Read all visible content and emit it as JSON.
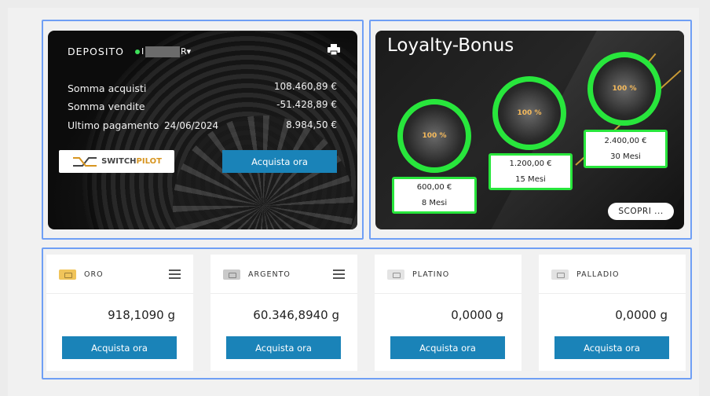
{
  "deposit": {
    "title": "DEPOSITO",
    "account_prefix": "I",
    "account_suffix": "R▾",
    "status_color": "#3ee05a",
    "rows": [
      {
        "label": "Somma acquisti",
        "value": "108.460,89 €"
      },
      {
        "label": "Somma vendite",
        "value": "-51.428,89 €"
      },
      {
        "label": "Ultimo pagamento",
        "date": "24/06/2024",
        "value": "8.984,50 €"
      }
    ],
    "logo_text_a": "SWITCH",
    "logo_text_b": "PILOT",
    "buy_label": "Acquista ora"
  },
  "loyalty": {
    "title": "Loyalty-Bonus",
    "tiers": [
      {
        "percent": "100 %",
        "amount": "600,00 €",
        "duration": "8 Mesi"
      },
      {
        "percent": "100 %",
        "amount": "1.200,00 €",
        "duration": "15 Mesi"
      },
      {
        "percent": "100 %",
        "amount": "2.400,00 €",
        "duration": "30 Mesi"
      }
    ],
    "discover_label": "SCOPRI ..."
  },
  "metals": [
    {
      "name": "ORO",
      "amount": "918,1090 g",
      "buy_label": "Acquista ora",
      "bar_color": "#f0c45a",
      "has_menu": true
    },
    {
      "name": "ARGENTO",
      "amount": "60.346,8940 g",
      "buy_label": "Acquista ora",
      "bar_color": "#c9c9c9",
      "has_menu": true
    },
    {
      "name": "PLATINO",
      "amount": "0,0000 g",
      "buy_label": "Acquista ora",
      "bar_color": "#e4e4e4",
      "has_menu": false
    },
    {
      "name": "PALLADIO",
      "amount": "0,0000 g",
      "buy_label": "Acquista ora",
      "bar_color": "#e2e2e2",
      "has_menu": false
    }
  ],
  "accent_color": "#1a83b8",
  "highlight_color": "#28e63c"
}
